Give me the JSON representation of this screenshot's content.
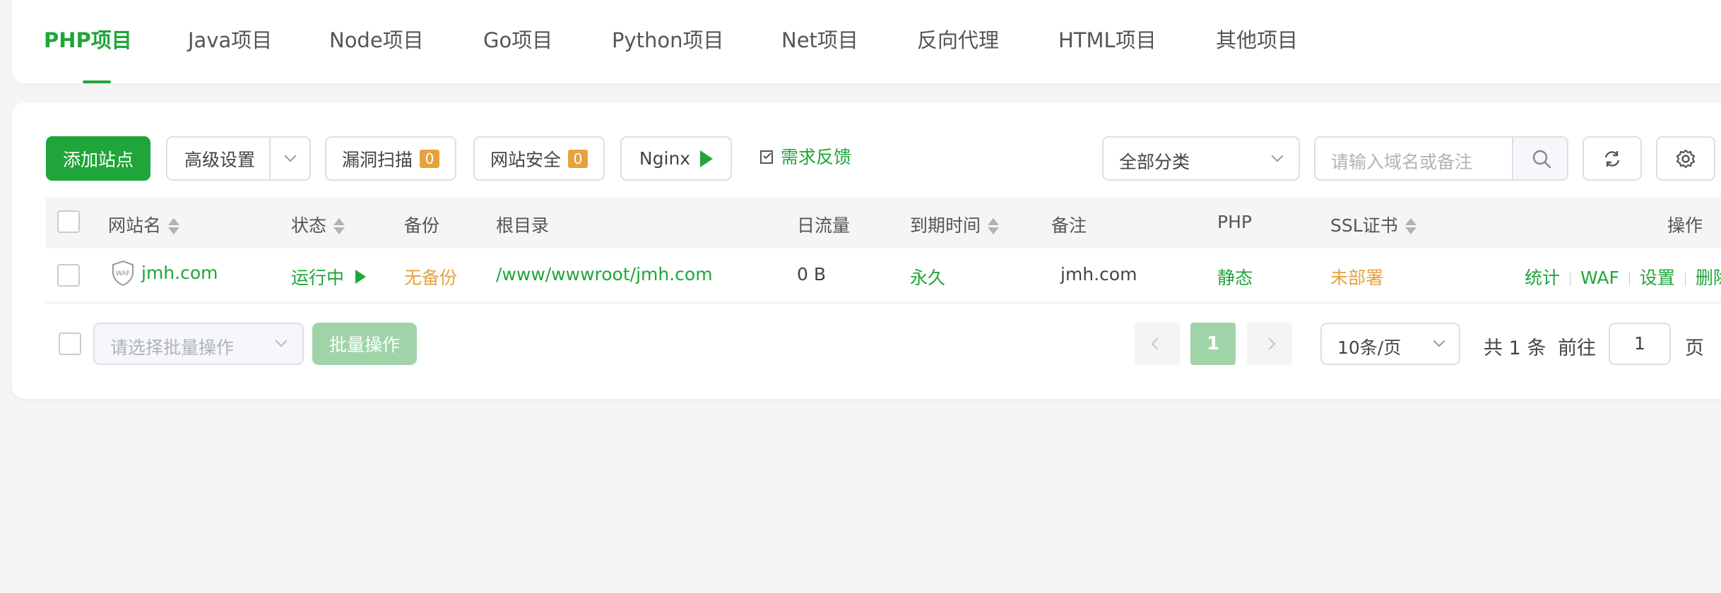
{
  "tabs": [
    {
      "label": "PHP项目",
      "active": true
    },
    {
      "label": "Java项目"
    },
    {
      "label": "Node项目"
    },
    {
      "label": "Go项目"
    },
    {
      "label": "Python项目"
    },
    {
      "label": "Net项目"
    },
    {
      "label": "反向代理"
    },
    {
      "label": "HTML项目"
    },
    {
      "label": "其他项目"
    }
  ],
  "toolbar": {
    "add_site": "添加站点",
    "advanced": "高级设置",
    "vuln_scan": "漏洞扫描",
    "vuln_count": "0",
    "site_security": "网站安全",
    "security_count": "0",
    "nginx": "Nginx",
    "feedback": "需求反馈",
    "category": "全部分类",
    "search_placeholder": "请输入域名或备注"
  },
  "table": {
    "headers": {
      "site_name": "网站名",
      "status": "状态",
      "backup": "备份",
      "root": "根目录",
      "traffic": "日流量",
      "expire": "到期时间",
      "remark": "备注",
      "php": "PHP",
      "ssl": "SSL证书",
      "ops": "操作"
    },
    "rows": [
      {
        "waf_label": "WAF",
        "site_name": "jmh.com",
        "status": "运行中",
        "backup": "无备份",
        "root": "/www/wwwroot/jmh.com",
        "traffic": "0 B",
        "expire": "永久",
        "remark": "jmh.com",
        "php": "静态",
        "ssl": "未部署",
        "ops": [
          "统计",
          "WAF",
          "设置",
          "删除"
        ]
      }
    ]
  },
  "footer": {
    "batch_placeholder": "请选择批量操作",
    "batch_button": "批量操作",
    "current_page": "1",
    "page_size": "10条/页",
    "total": "共 1 条",
    "goto_label": "前往",
    "goto_value": "1",
    "page_suffix": "页"
  },
  "colors": {
    "accent": "#20a53a",
    "warning": "#e6a23c"
  }
}
